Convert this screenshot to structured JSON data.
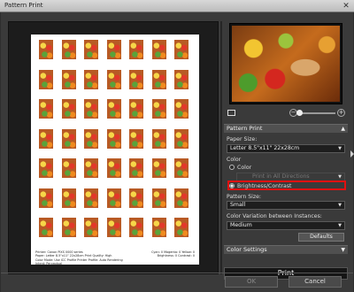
{
  "window": {
    "title": "Pattern Print",
    "close_glyph": "✕"
  },
  "preview": {
    "page_footer_left": "Printer: Canon PIXS 0000 series\nPaper: Letter 8.5\"x11\" 22x28cm   Print Quality: High\nColor Mode: Use ICC Profile   Printer Profile: Auto   Rendering Intent: Perceptual",
    "page_footer_right": "Cyan: 0  Magenta: 0  Yellow: 0\nBrightness: 0  Contrast: 0"
  },
  "pattern_print": {
    "header": "Pattern Print",
    "paper_size_label": "Paper Size:",
    "paper_size_value": "Letter 8.5\"x11\" 22x28cm",
    "color_label": "Color",
    "radio_color": "Color",
    "direction_value": "Print in All Directions",
    "radio_brightness": "Brightness/Contrast",
    "pattern_size_label": "Pattern Size:",
    "pattern_size_value": "Small",
    "variation_label": "Color Variation between Instances:",
    "variation_value": "Medium",
    "defaults_label": "Defaults"
  },
  "color_settings": {
    "header": "Color Settings"
  },
  "actions": {
    "print": "Print",
    "ok": "OK",
    "cancel": "Cancel"
  },
  "zoom": {
    "minus": "−",
    "plus": "+",
    "level": 0.0
  }
}
